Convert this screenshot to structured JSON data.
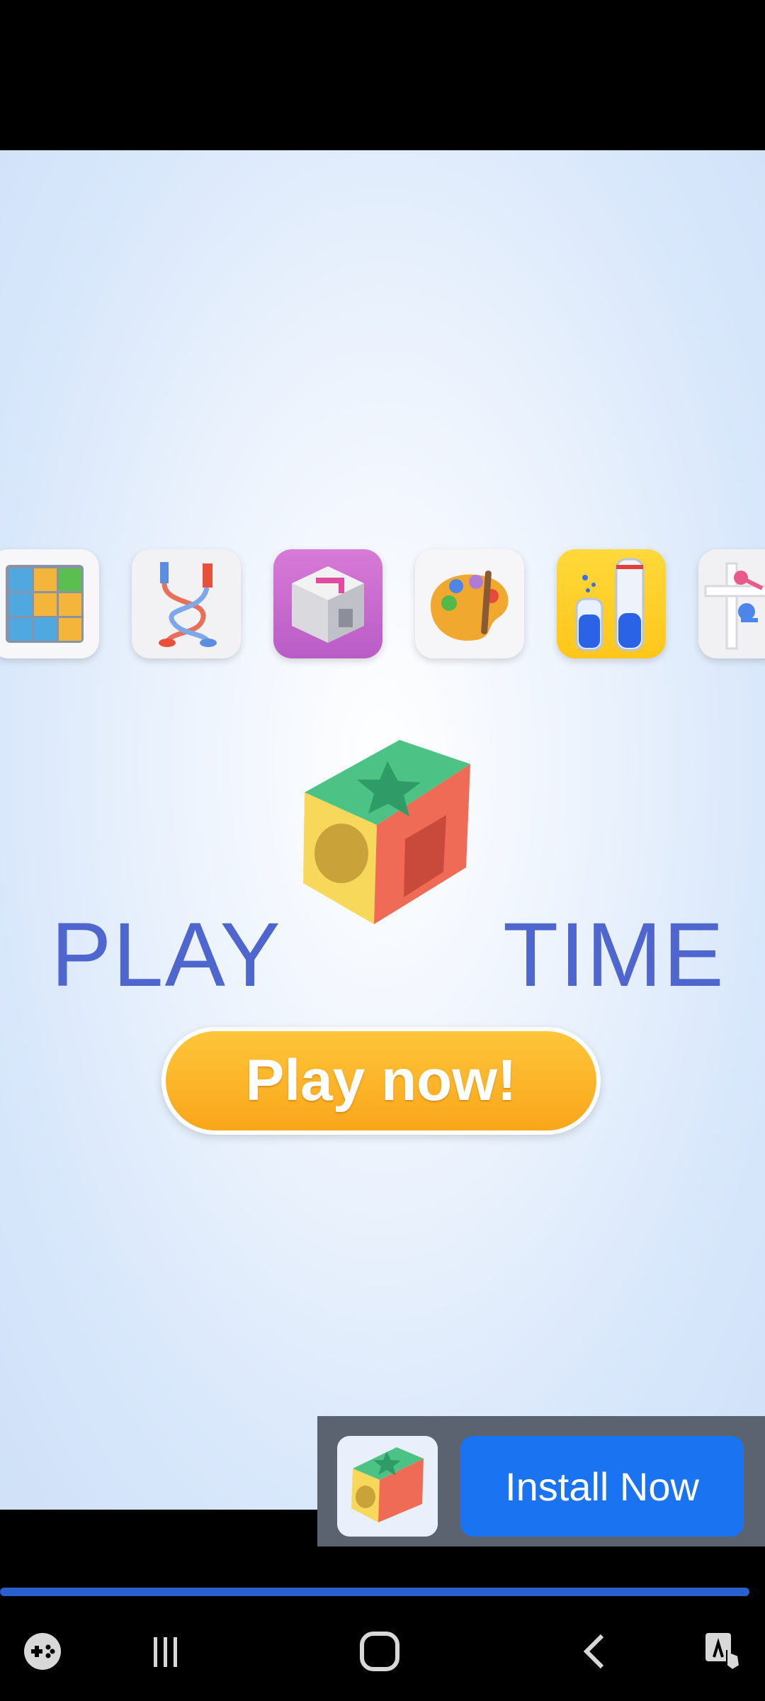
{
  "ad": {
    "logo_left": "PLAY",
    "logo_right": "TIME",
    "play_button": "Play now!"
  },
  "install_banner": {
    "button_label": "Install Now"
  },
  "app_icons": [
    "block-puzzle-icon",
    "rope-untangle-icon",
    "cube-puzzle-icon",
    "paint-palette-icon",
    "water-sort-icon",
    "pin-pull-icon"
  ],
  "navigation": {
    "items": [
      "game-launcher-icon",
      "recent-apps-icon",
      "home-icon",
      "back-icon",
      "accessibility-icon"
    ]
  },
  "colors": {
    "accent_blue": "#1a73f0",
    "logo_blue": "#4f66cf",
    "play_button_orange": "#f9a61a",
    "progress_blue": "#2a5fd0"
  }
}
